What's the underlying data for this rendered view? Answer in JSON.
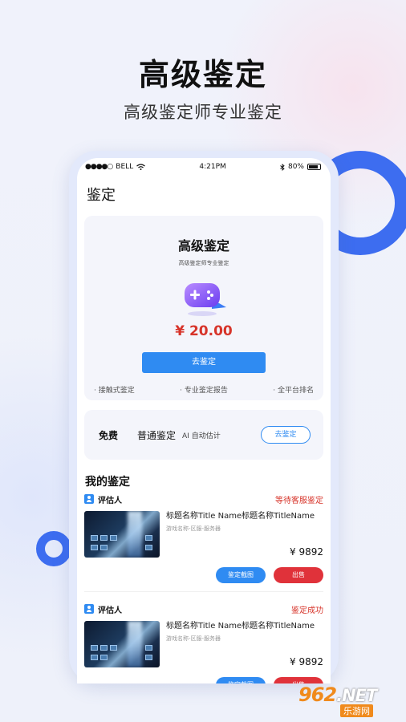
{
  "promo": {
    "headline": "高级鉴定",
    "subline": "高级鉴定师专业鉴定"
  },
  "status_bar": {
    "dots": "●●●●○",
    "carrier": "BELL",
    "time": "4:21PM",
    "battery": "80%"
  },
  "page": {
    "title": "鉴定"
  },
  "premium_card": {
    "title": "高级鉴定",
    "subtitle": "高级鉴定师专业鉴定",
    "price": "¥ 20.00",
    "button": "去鉴定",
    "features": [
      "· 接触式鉴定",
      "· 专业鉴定报告",
      "· 全平台排名"
    ]
  },
  "free_card": {
    "free_label": "免费",
    "type_label": "普通鉴定",
    "ai_label": "AI 自动估计",
    "button": "去鉴定"
  },
  "my_section": {
    "title": "我的鉴定"
  },
  "records": [
    {
      "evaluator": "评估人",
      "status": "等待客服鉴定",
      "name": "标题名称Title Name标题名称TitleName",
      "sub": "游戏名称-区服-服务器",
      "price": "¥ 9892",
      "action_primary": "鉴定截图",
      "action_secondary": "出售"
    },
    {
      "evaluator": "评估人",
      "status": "鉴定成功",
      "name": "标题名称Title Name标题名称TitleName",
      "sub": "游戏名称-区服-服务器",
      "price": "¥ 9892",
      "action_primary": "鉴定截图",
      "action_secondary": "出售"
    }
  ],
  "watermark": {
    "brand": "962",
    "suffix": ".NET",
    "caption": "乐游网"
  },
  "colors": {
    "accent": "#2f8bf2",
    "ring": "#3d6df0",
    "price": "#d7342a",
    "sell": "#e0323a"
  }
}
